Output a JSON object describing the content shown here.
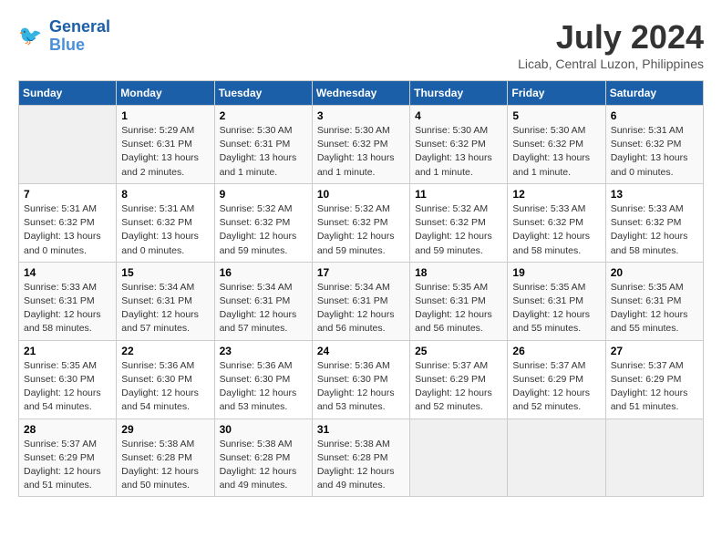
{
  "header": {
    "logo_line1": "General",
    "logo_line2": "Blue",
    "month": "July 2024",
    "location": "Licab, Central Luzon, Philippines"
  },
  "columns": [
    "Sunday",
    "Monday",
    "Tuesday",
    "Wednesday",
    "Thursday",
    "Friday",
    "Saturday"
  ],
  "weeks": [
    [
      {
        "num": "",
        "info": ""
      },
      {
        "num": "1",
        "info": "Sunrise: 5:29 AM\nSunset: 6:31 PM\nDaylight: 13 hours\nand 2 minutes."
      },
      {
        "num": "2",
        "info": "Sunrise: 5:30 AM\nSunset: 6:31 PM\nDaylight: 13 hours\nand 1 minute."
      },
      {
        "num": "3",
        "info": "Sunrise: 5:30 AM\nSunset: 6:32 PM\nDaylight: 13 hours\nand 1 minute."
      },
      {
        "num": "4",
        "info": "Sunrise: 5:30 AM\nSunset: 6:32 PM\nDaylight: 13 hours\nand 1 minute."
      },
      {
        "num": "5",
        "info": "Sunrise: 5:30 AM\nSunset: 6:32 PM\nDaylight: 13 hours\nand 1 minute."
      },
      {
        "num": "6",
        "info": "Sunrise: 5:31 AM\nSunset: 6:32 PM\nDaylight: 13 hours\nand 0 minutes."
      }
    ],
    [
      {
        "num": "7",
        "info": "Sunrise: 5:31 AM\nSunset: 6:32 PM\nDaylight: 13 hours\nand 0 minutes."
      },
      {
        "num": "8",
        "info": "Sunrise: 5:31 AM\nSunset: 6:32 PM\nDaylight: 13 hours\nand 0 minutes."
      },
      {
        "num": "9",
        "info": "Sunrise: 5:32 AM\nSunset: 6:32 PM\nDaylight: 12 hours\nand 59 minutes."
      },
      {
        "num": "10",
        "info": "Sunrise: 5:32 AM\nSunset: 6:32 PM\nDaylight: 12 hours\nand 59 minutes."
      },
      {
        "num": "11",
        "info": "Sunrise: 5:32 AM\nSunset: 6:32 PM\nDaylight: 12 hours\nand 59 minutes."
      },
      {
        "num": "12",
        "info": "Sunrise: 5:33 AM\nSunset: 6:32 PM\nDaylight: 12 hours\nand 58 minutes."
      },
      {
        "num": "13",
        "info": "Sunrise: 5:33 AM\nSunset: 6:32 PM\nDaylight: 12 hours\nand 58 minutes."
      }
    ],
    [
      {
        "num": "14",
        "info": "Sunrise: 5:33 AM\nSunset: 6:31 PM\nDaylight: 12 hours\nand 58 minutes."
      },
      {
        "num": "15",
        "info": "Sunrise: 5:34 AM\nSunset: 6:31 PM\nDaylight: 12 hours\nand 57 minutes."
      },
      {
        "num": "16",
        "info": "Sunrise: 5:34 AM\nSunset: 6:31 PM\nDaylight: 12 hours\nand 57 minutes."
      },
      {
        "num": "17",
        "info": "Sunrise: 5:34 AM\nSunset: 6:31 PM\nDaylight: 12 hours\nand 56 minutes."
      },
      {
        "num": "18",
        "info": "Sunrise: 5:35 AM\nSunset: 6:31 PM\nDaylight: 12 hours\nand 56 minutes."
      },
      {
        "num": "19",
        "info": "Sunrise: 5:35 AM\nSunset: 6:31 PM\nDaylight: 12 hours\nand 55 minutes."
      },
      {
        "num": "20",
        "info": "Sunrise: 5:35 AM\nSunset: 6:31 PM\nDaylight: 12 hours\nand 55 minutes."
      }
    ],
    [
      {
        "num": "21",
        "info": "Sunrise: 5:35 AM\nSunset: 6:30 PM\nDaylight: 12 hours\nand 54 minutes."
      },
      {
        "num": "22",
        "info": "Sunrise: 5:36 AM\nSunset: 6:30 PM\nDaylight: 12 hours\nand 54 minutes."
      },
      {
        "num": "23",
        "info": "Sunrise: 5:36 AM\nSunset: 6:30 PM\nDaylight: 12 hours\nand 53 minutes."
      },
      {
        "num": "24",
        "info": "Sunrise: 5:36 AM\nSunset: 6:30 PM\nDaylight: 12 hours\nand 53 minutes."
      },
      {
        "num": "25",
        "info": "Sunrise: 5:37 AM\nSunset: 6:29 PM\nDaylight: 12 hours\nand 52 minutes."
      },
      {
        "num": "26",
        "info": "Sunrise: 5:37 AM\nSunset: 6:29 PM\nDaylight: 12 hours\nand 52 minutes."
      },
      {
        "num": "27",
        "info": "Sunrise: 5:37 AM\nSunset: 6:29 PM\nDaylight: 12 hours\nand 51 minutes."
      }
    ],
    [
      {
        "num": "28",
        "info": "Sunrise: 5:37 AM\nSunset: 6:29 PM\nDaylight: 12 hours\nand 51 minutes."
      },
      {
        "num": "29",
        "info": "Sunrise: 5:38 AM\nSunset: 6:28 PM\nDaylight: 12 hours\nand 50 minutes."
      },
      {
        "num": "30",
        "info": "Sunrise: 5:38 AM\nSunset: 6:28 PM\nDaylight: 12 hours\nand 49 minutes."
      },
      {
        "num": "31",
        "info": "Sunrise: 5:38 AM\nSunset: 6:28 PM\nDaylight: 12 hours\nand 49 minutes."
      },
      {
        "num": "",
        "info": ""
      },
      {
        "num": "",
        "info": ""
      },
      {
        "num": "",
        "info": ""
      }
    ]
  ]
}
